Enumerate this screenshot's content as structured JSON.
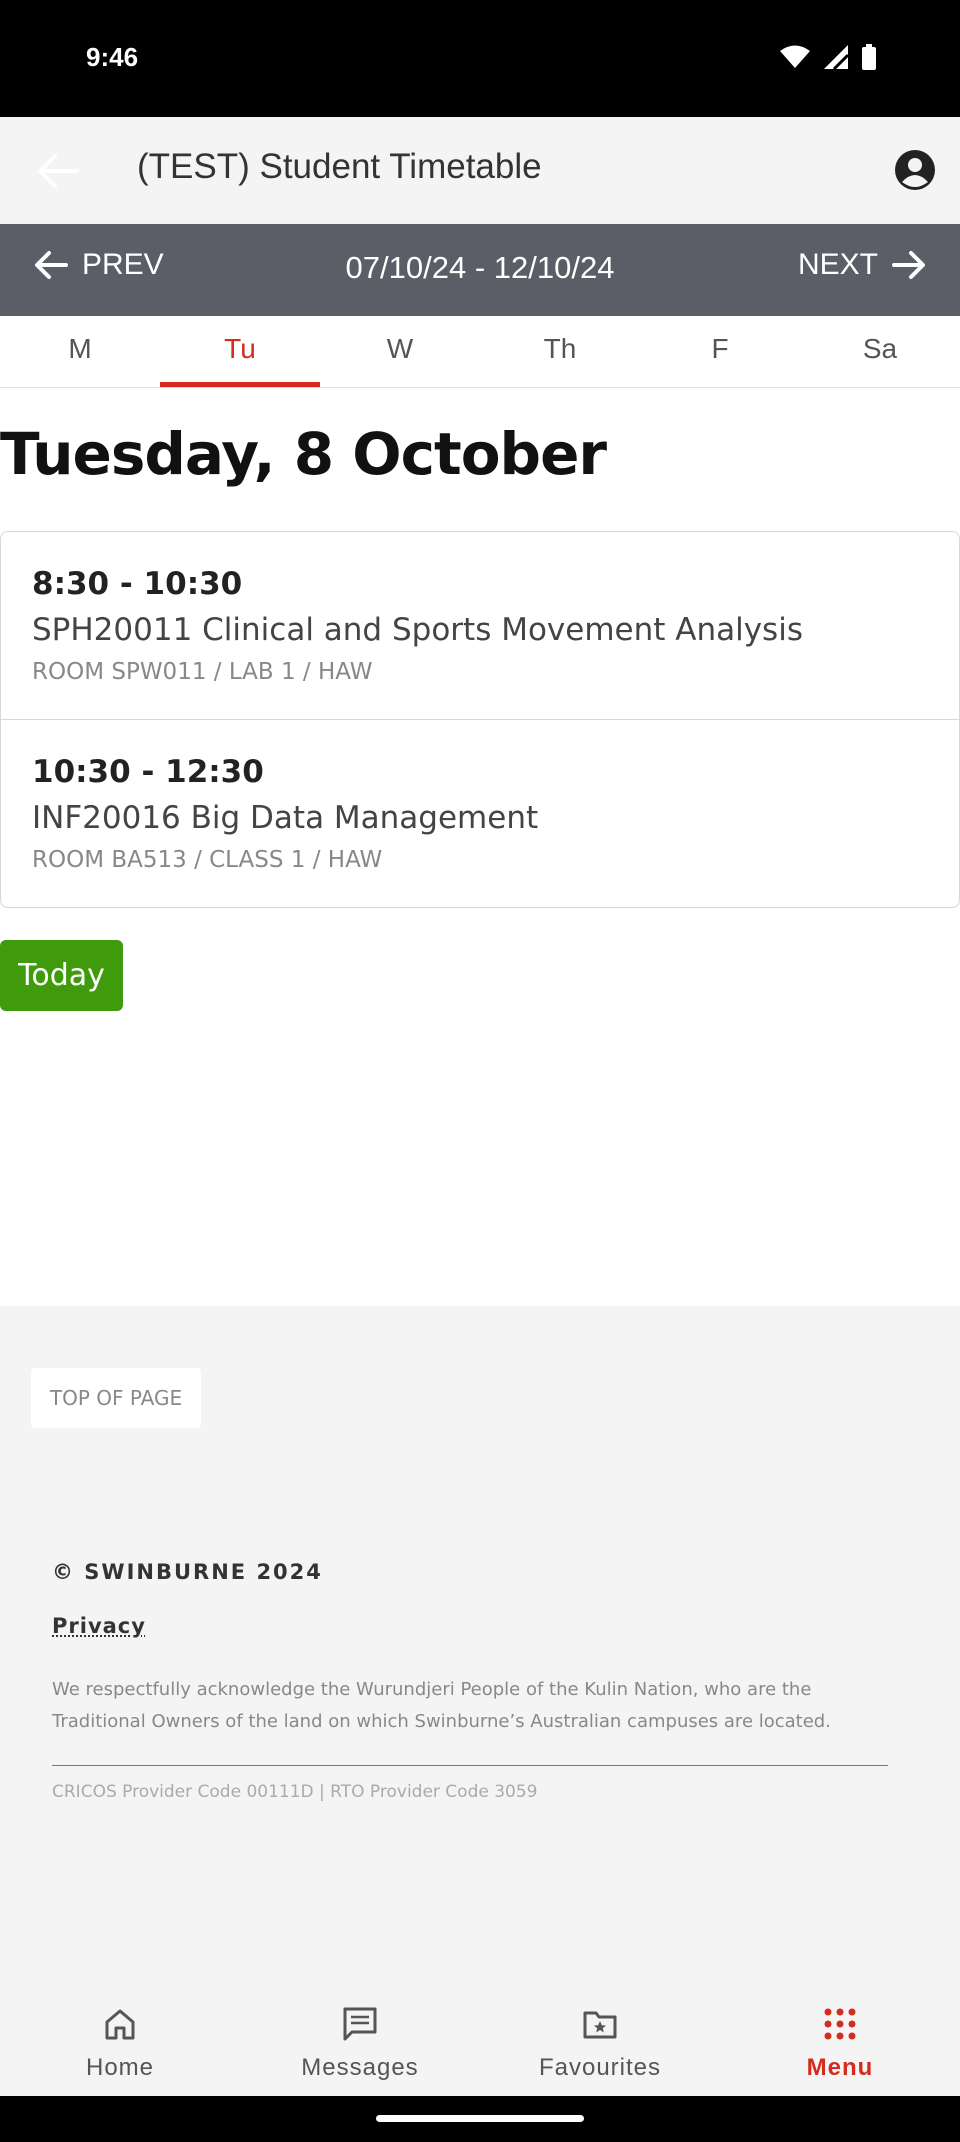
{
  "status_bar": {
    "time": "9:46"
  },
  "app_bar": {
    "title": "(TEST) Student Timetable"
  },
  "week_nav": {
    "prev_label": "PREV",
    "range": "07/10/24 - 12/10/24",
    "next_label": "NEXT"
  },
  "day_tabs": [
    {
      "label": "M",
      "active": false
    },
    {
      "label": "Tu",
      "active": true
    },
    {
      "label": "W",
      "active": false
    },
    {
      "label": "Th",
      "active": false
    },
    {
      "label": "F",
      "active": false
    },
    {
      "label": "Sa",
      "active": false
    }
  ],
  "day_heading": "Tuesday, 8 October",
  "classes": [
    {
      "time": "8:30 - 10:30",
      "name": "SPH20011 Clinical and Sports Movement Analysis",
      "room": "ROOM SPW011 / LAB 1 / HAW"
    },
    {
      "time": "10:30 - 12:30",
      "name": "INF20016 Big Data Management",
      "room": "ROOM BA513 / CLASS 1 / HAW"
    }
  ],
  "today_button": "Today",
  "footer": {
    "top_of_page": "TOP OF PAGE",
    "copyright": "© SWINBURNE 2024",
    "privacy": "Privacy",
    "acknowledgement": "We respectfully acknowledge the Wurundjeri People of the Kulin Nation, who are the Traditional Owners of the land on which Swinburne’s Australian campuses are located.",
    "provider_codes": "CRICOS Provider Code 00111D | RTO Provider Code 3059"
  },
  "bottom_nav": [
    {
      "label": "Home",
      "icon": "home-icon",
      "active": false
    },
    {
      "label": "Messages",
      "icon": "messages-icon",
      "active": false
    },
    {
      "label": "Favourites",
      "icon": "favourites-folder-icon",
      "active": false
    },
    {
      "label": "Menu",
      "icon": "menu-grid-icon",
      "active": true
    }
  ],
  "colors": {
    "accent": "#d52b1e",
    "today_button": "#3f9b0b",
    "week_bar": "#5b5e66"
  }
}
